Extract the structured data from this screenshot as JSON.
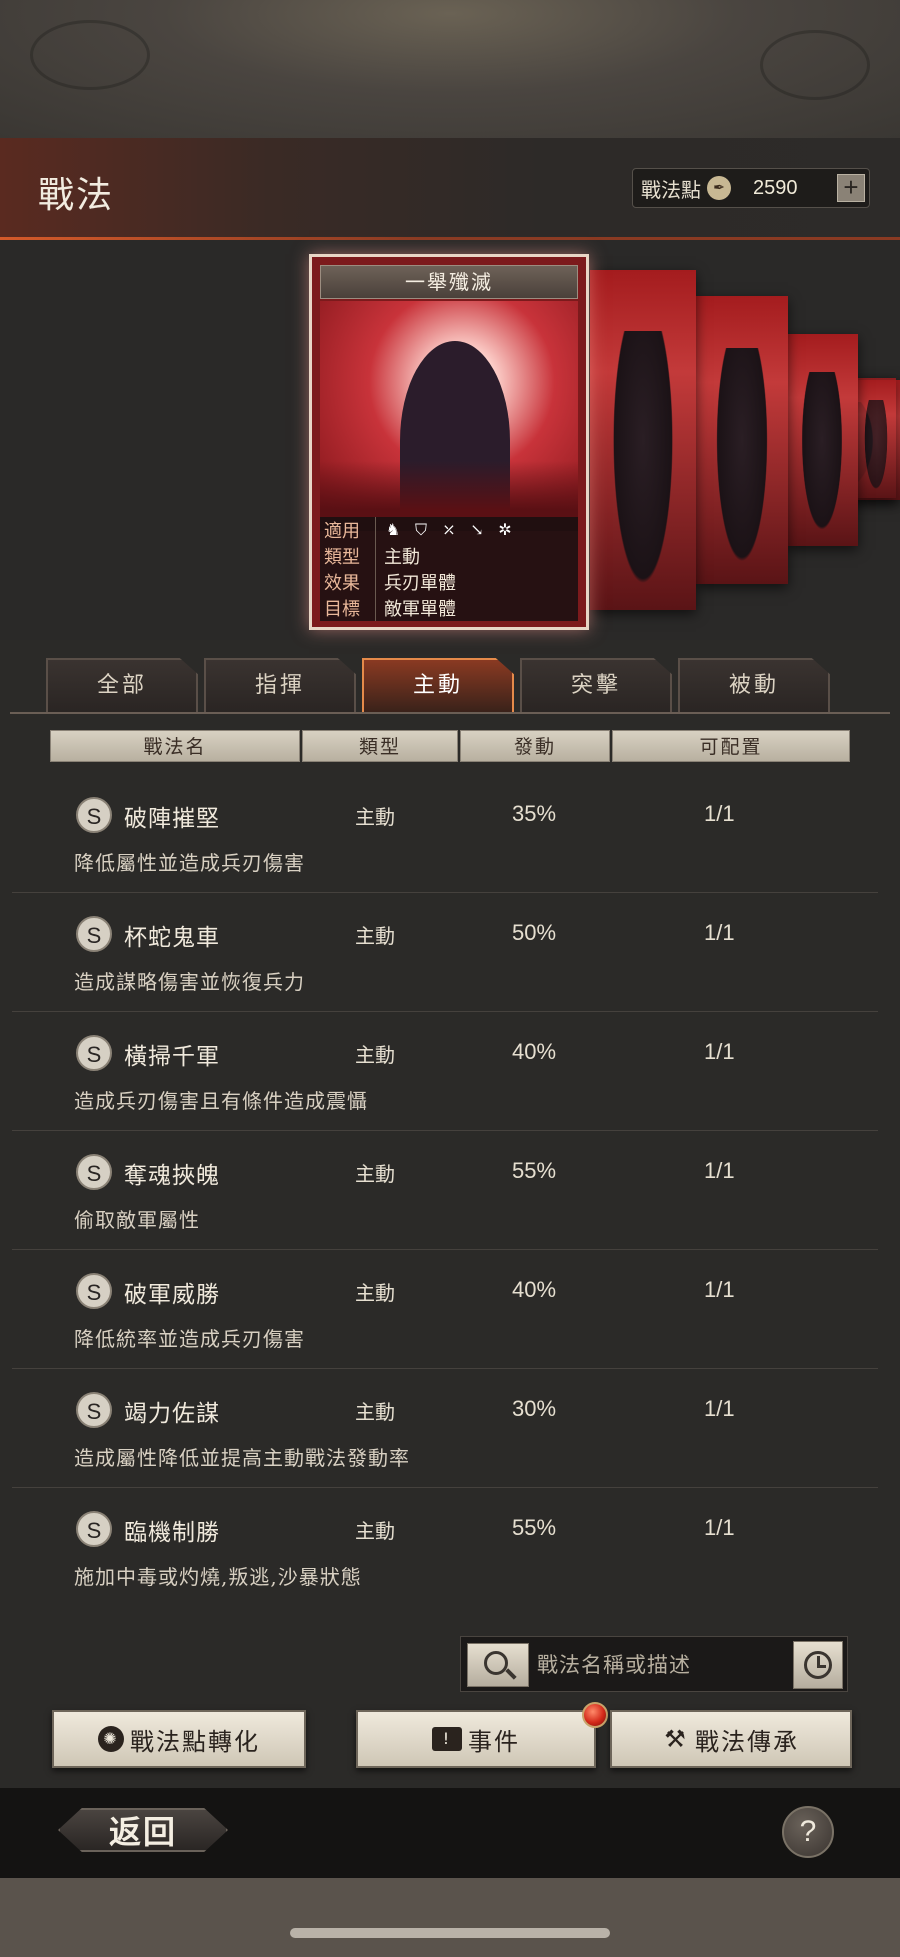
{
  "header": {
    "title": "戰法",
    "points_label": "戰法點",
    "points_icon": "quill-icon",
    "points_value": "2590",
    "plus_label": "+"
  },
  "card": {
    "name": "一舉殲滅",
    "info": [
      {
        "key": "適用",
        "value": ""
      },
      {
        "key": "類型",
        "value": "主動"
      },
      {
        "key": "效果",
        "value": "兵刃單體"
      },
      {
        "key": "目標",
        "value": "敵軍單體"
      }
    ],
    "applicable_icons": [
      "cavalry-icon",
      "shield-icon",
      "bow-icon",
      "spear-icon",
      "wheel-icon"
    ]
  },
  "tabs": [
    "全部",
    "指揮",
    "主動",
    "突擊",
    "被動"
  ],
  "active_tab": "主動",
  "table_headers": [
    "戰法名",
    "類型",
    "發動",
    "可配置"
  ],
  "tactics": [
    {
      "grade": "S",
      "name": "破陣摧堅",
      "type": "主動",
      "rate": "35%",
      "avail": "1/1",
      "desc": "降低屬性並造成兵刃傷害"
    },
    {
      "grade": "S",
      "name": "杯蛇鬼車",
      "type": "主動",
      "rate": "50%",
      "avail": "1/1",
      "desc": "造成謀略傷害並恢復兵力"
    },
    {
      "grade": "S",
      "name": "橫掃千軍",
      "type": "主動",
      "rate": "40%",
      "avail": "1/1",
      "desc": "造成兵刃傷害且有條件造成震懾"
    },
    {
      "grade": "S",
      "name": "奪魂挾魄",
      "type": "主動",
      "rate": "55%",
      "avail": "1/1",
      "desc": "偷取敵軍屬性"
    },
    {
      "grade": "S",
      "name": "破軍威勝",
      "type": "主動",
      "rate": "40%",
      "avail": "1/1",
      "desc": "降低統率並造成兵刃傷害"
    },
    {
      "grade": "S",
      "name": "竭力佐謀",
      "type": "主動",
      "rate": "30%",
      "avail": "1/1",
      "desc": "造成屬性降低並提高主動戰法發動率"
    },
    {
      "grade": "S",
      "name": "臨機制勝",
      "type": "主動",
      "rate": "55%",
      "avail": "1/1",
      "desc": "施加中毒或灼燒,叛逃,沙暴狀態"
    }
  ],
  "search": {
    "placeholder": "戰法名稱或描述",
    "search_icon": "magnifier-icon",
    "history_icon": "clock-icon"
  },
  "buttons": {
    "convert_label": "戰法點轉化",
    "event_label": "事件",
    "inherit_label": "戰法傳承"
  },
  "footer": {
    "back_label": "返回",
    "help_label": "?"
  }
}
